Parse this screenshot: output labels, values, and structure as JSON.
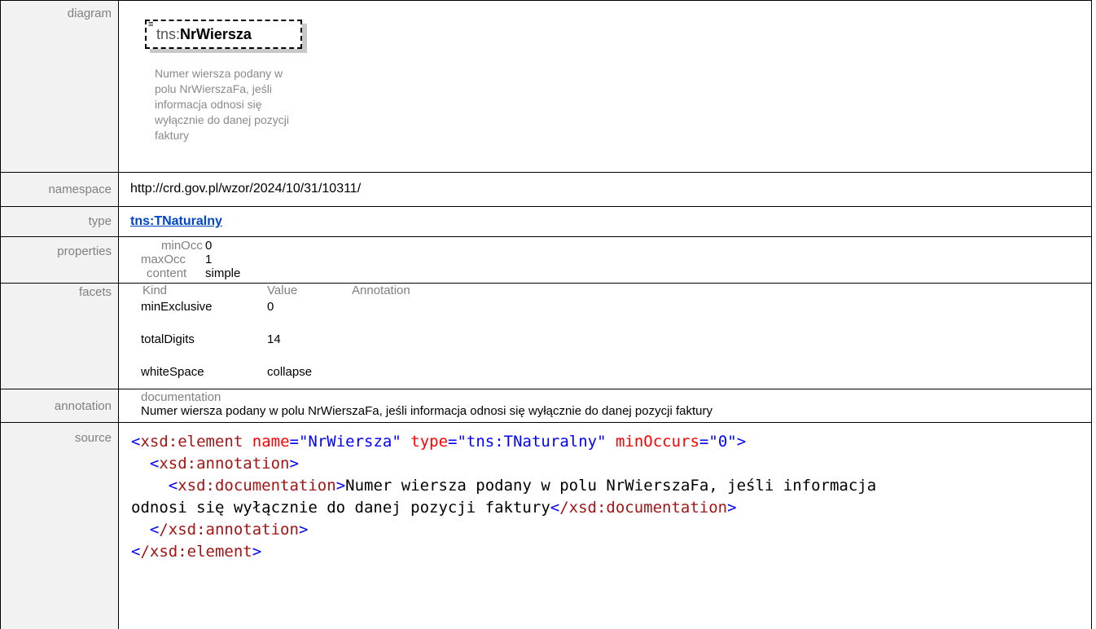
{
  "rows": {
    "diagram_label": "diagram",
    "namespace_label": "namespace",
    "type_label": "type",
    "properties_label": "properties",
    "facets_label": "facets",
    "annotation_label": "annotation",
    "source_label": "source"
  },
  "diagram": {
    "element_prefix": "tns:",
    "element_name": "NrWiersza",
    "doc_lines": [
      "Numer wiersza podany w",
      "polu NrWierszaFa, jeśli",
      "informacja odnosi się",
      "wyłącznie do danej pozycji",
      "faktury"
    ]
  },
  "namespace": "http://crd.gov.pl/wzor/2024/10/31/10311/",
  "type": "tns:TNaturalny",
  "properties": [
    {
      "key": "minOcc",
      "value": "0"
    },
    {
      "key": "maxOcc",
      "value": "1"
    },
    {
      "key": "content",
      "value": "simple"
    }
  ],
  "facets": {
    "headers": [
      "Kind",
      "Value",
      "Annotation"
    ],
    "rows": [
      {
        "kind": "minExclusive",
        "value": "0"
      },
      {
        "kind": "totalDigits",
        "value": "14"
      },
      {
        "kind": "whiteSpace",
        "value": "collapse"
      }
    ]
  },
  "annotation": {
    "key": "documentation",
    "text": "Numer wiersza podany w polu NrWierszaFa, jeśli informacja odnosi się wyłącznie do danej pozycji faktury"
  },
  "source": {
    "l1_open": "<",
    "l1_tag": "xsd:element",
    "l1_a1": "name",
    "l1_v1": "\"NrWiersza\"",
    "l1_a2": "type",
    "l1_v2": "\"tns:TNaturalny\"",
    "l1_a3": "minOccurs",
    "l1_v3": "\"0\"",
    "l2_tag": "xsd:annotation",
    "l3_tag": "xsd:documentation",
    "l3_text": "Numer wiersza podany w polu NrWierszaFa, jeśli informacja",
    "l4_text": "odnosi się wyłącznie do danej pozycji faktury",
    "l4_tag": "/xsd:documentation",
    "l5_tag": "/xsd:annotation",
    "l6_tag": "/xsd:element",
    "eq": "=",
    "lt": "<",
    "gt": ">"
  }
}
